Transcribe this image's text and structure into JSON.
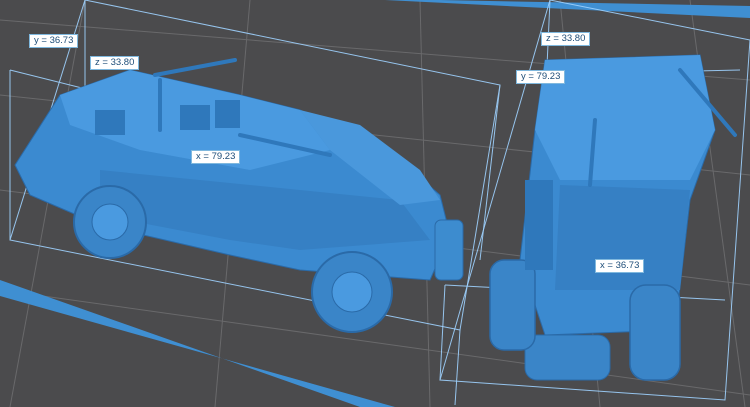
{
  "scene": {
    "background_color": "#4b4b4d",
    "grid_color": "#6a6a6c",
    "model_color": "#3f8fd2",
    "bounding_box_color": "#9fd2ff"
  },
  "left_model": {
    "labels": {
      "y": "y = 36.73",
      "z": "z = 33.80",
      "x": "x = 79.23"
    }
  },
  "right_model": {
    "labels": {
      "z": "z = 33.80",
      "y": "y = 79.23",
      "x": "x = 36.73"
    }
  }
}
